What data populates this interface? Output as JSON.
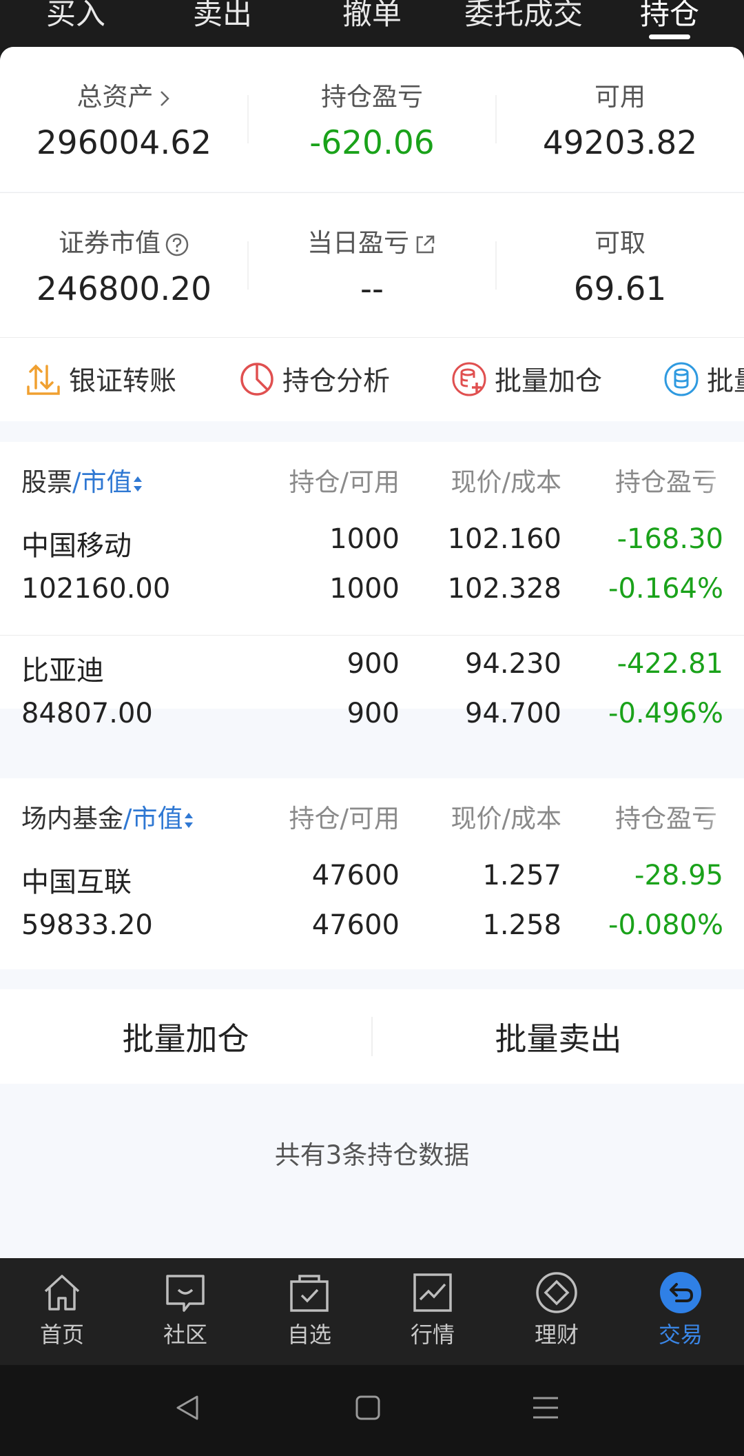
{
  "top_tabs": [
    {
      "label": "买入"
    },
    {
      "label": "卖出"
    },
    {
      "label": "撤单"
    },
    {
      "label": "委托成交"
    },
    {
      "label": "持仓",
      "active": true
    }
  ],
  "summary": {
    "total_assets_label": "总资产",
    "total_assets_value": "296004.62",
    "position_pl_label": "持仓盈亏",
    "position_pl_value": "-620.06",
    "available_label": "可用",
    "available_value": "49203.82",
    "market_value_label": "证券市值",
    "market_value_value": "246800.20",
    "daily_pl_label": "当日盈亏",
    "daily_pl_value": "--",
    "withdrawable_label": "可取",
    "withdrawable_value": "69.61"
  },
  "actions": [
    {
      "label": "银证转账",
      "icon": "transfer-icon"
    },
    {
      "label": "持仓分析",
      "icon": "pie-chart-icon"
    },
    {
      "label": "批量加仓",
      "icon": "database-add-icon"
    },
    {
      "label": "批量",
      "icon": "database-icon"
    }
  ],
  "stocks": {
    "header": {
      "name": "股票",
      "slash": "/",
      "sort": "市值",
      "col2": "持仓/可用",
      "col3": "现价/成本",
      "col4": "持仓盈亏"
    },
    "rows": [
      {
        "name": "中国移动",
        "market_value": "102160.00",
        "position": "1000",
        "available": "1000",
        "price": "102.160",
        "cost": "102.328",
        "pl": "-168.30",
        "pl_pct": "-0.164%"
      },
      {
        "name": "比亚迪",
        "market_value": "84807.00",
        "position": "900",
        "available": "900",
        "price": "94.230",
        "cost": "94.700",
        "pl": "-422.81",
        "pl_pct": "-0.496%"
      }
    ]
  },
  "funds": {
    "header": {
      "name": "场内基金",
      "slash": "/",
      "sort": "市值",
      "col2": "持仓/可用",
      "col3": "现价/成本",
      "col4": "持仓盈亏"
    },
    "rows": [
      {
        "name": "中国互联",
        "market_value": "59833.20",
        "position": "47600",
        "available": "47600",
        "price": "1.257",
        "cost": "1.258",
        "pl": "-28.95",
        "pl_pct": "-0.080%"
      }
    ]
  },
  "batch": {
    "add_label": "批量加仓",
    "sell_label": "批量卖出"
  },
  "footnote": "共有3条持仓数据",
  "bottom_nav": [
    {
      "label": "首页",
      "icon": "home-icon"
    },
    {
      "label": "社区",
      "icon": "community-icon"
    },
    {
      "label": "自选",
      "icon": "watchlist-icon"
    },
    {
      "label": "行情",
      "icon": "market-icon"
    },
    {
      "label": "理财",
      "icon": "wealth-icon"
    },
    {
      "label": "交易",
      "icon": "trade-icon",
      "active": true
    }
  ],
  "colors": {
    "loss_green": "#1aa21a",
    "accent_blue": "#2f78d3",
    "orange": "#f0a030",
    "red": "#e05050"
  }
}
